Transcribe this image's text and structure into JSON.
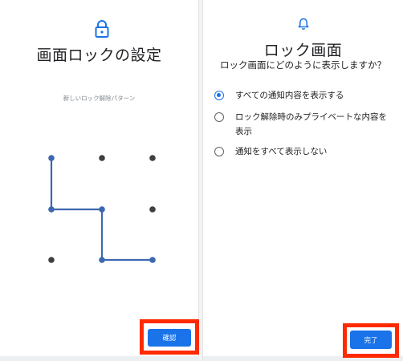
{
  "left_screen": {
    "title": "画面ロックの設定",
    "caption": "新しいロック解除パターン",
    "confirm_label": "確認",
    "icon": "lock-icon"
  },
  "right_screen": {
    "title": "ロック画面",
    "subtitle": "ロック画面にどのように表示しますか？",
    "icon": "bell-icon",
    "options": [
      {
        "label": "すべての通知内容を表示する",
        "selected": true
      },
      {
        "label": "ロック解除時のみプライベートな内容を表示",
        "selected": false
      },
      {
        "label": "通知をすべて表示しない",
        "selected": false
      }
    ],
    "done_label": "完了"
  },
  "colors": {
    "accent": "#1a73e8",
    "pattern_line": "#3d67b0",
    "dot": "#3c4043",
    "highlight": "#ff2a00"
  }
}
